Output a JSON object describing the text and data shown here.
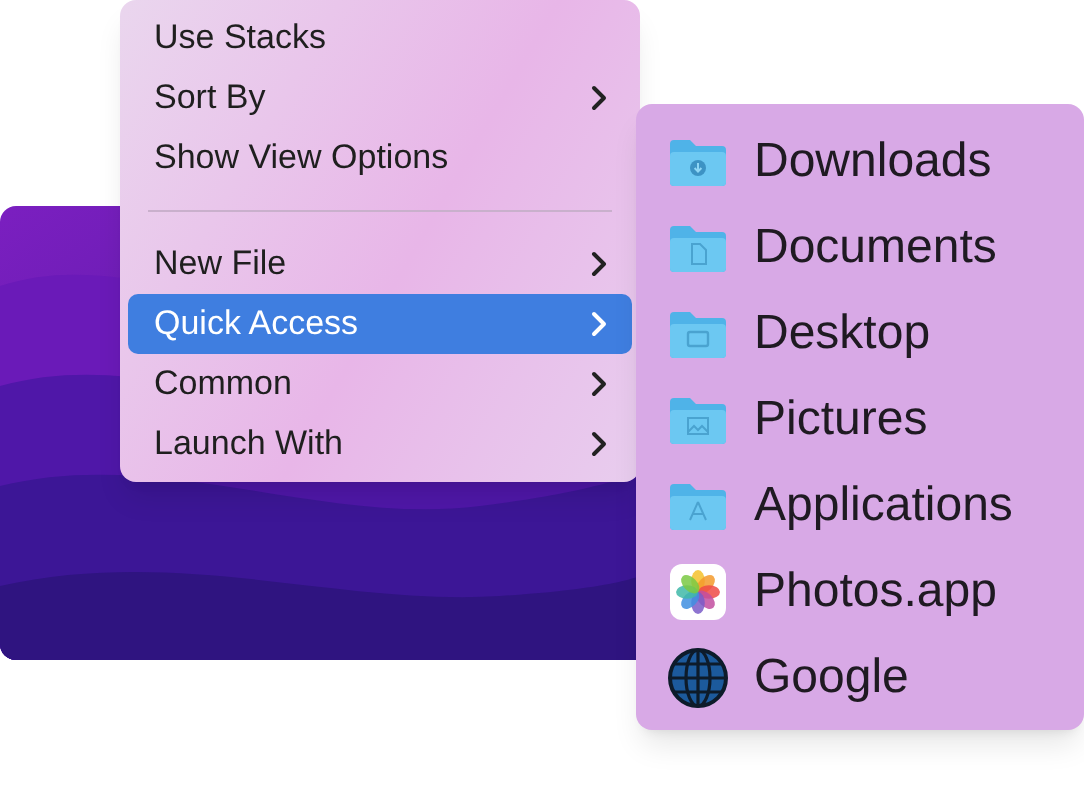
{
  "menu": {
    "items": [
      {
        "kind": "item",
        "label": "Use Stacks",
        "submenu": false,
        "selected": false
      },
      {
        "kind": "item",
        "label": "Sort By",
        "submenu": true,
        "selected": false
      },
      {
        "kind": "item",
        "label": "Show View Options",
        "submenu": false,
        "selected": false
      },
      {
        "kind": "separator"
      },
      {
        "kind": "item",
        "label": "New File",
        "submenu": true,
        "selected": false
      },
      {
        "kind": "item",
        "label": "Quick Access",
        "submenu": true,
        "selected": true
      },
      {
        "kind": "item",
        "label": "Common",
        "submenu": true,
        "selected": false
      },
      {
        "kind": "item",
        "label": "Launch With",
        "submenu": true,
        "selected": false
      }
    ]
  },
  "submenu": {
    "items": [
      {
        "kind": "downloads",
        "label": "Downloads"
      },
      {
        "kind": "documents",
        "label": "Documents"
      },
      {
        "kind": "desktop",
        "label": "Desktop"
      },
      {
        "kind": "pictures",
        "label": "Pictures"
      },
      {
        "kind": "applications",
        "label": "Applications"
      },
      {
        "kind": "photos",
        "label": "Photos.app"
      },
      {
        "kind": "globe",
        "label": "Google"
      }
    ]
  }
}
